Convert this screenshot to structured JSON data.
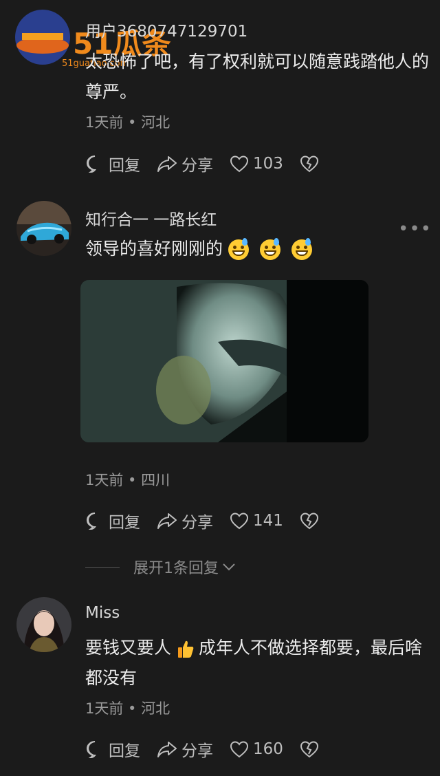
{
  "watermark": {
    "main": "51瓜条",
    "sub": "51guatiao.com"
  },
  "comments": [
    {
      "username": "用户3680747129701",
      "text": "太恐怖了吧，有了权利就可以随意践踏他人的尊严。",
      "meta": "1天前 • 河北",
      "reply_label": "回复",
      "share_label": "分享",
      "likes": "103"
    },
    {
      "username": "知行合一 一路长红",
      "text": "领导的喜好刚刚的",
      "meta": "1天前 • 四川",
      "reply_label": "回复",
      "share_label": "分享",
      "likes": "141",
      "expand_label": "展开1条回复"
    },
    {
      "username": "Miss",
      "text_before_emoji": "要钱又要人",
      "text_after_emoji": "成年人不做选择都要，最后啥都没有",
      "meta": "1天前 • 河北",
      "reply_label": "回复",
      "share_label": "分享",
      "likes": "160"
    }
  ],
  "icons": {
    "reply": "reply-icon",
    "share": "share-icon",
    "like": "heart-icon",
    "dislike": "broken-heart-icon",
    "more": "more-dots-icon",
    "emoji": "grinning-sweat-emoji",
    "thumbs_up": "thumbs-up-emoji"
  },
  "colors": {
    "background": "#1b1b1b",
    "text": "#ececec",
    "muted": "#9a9a9a",
    "watermark": "#f08a1c"
  }
}
